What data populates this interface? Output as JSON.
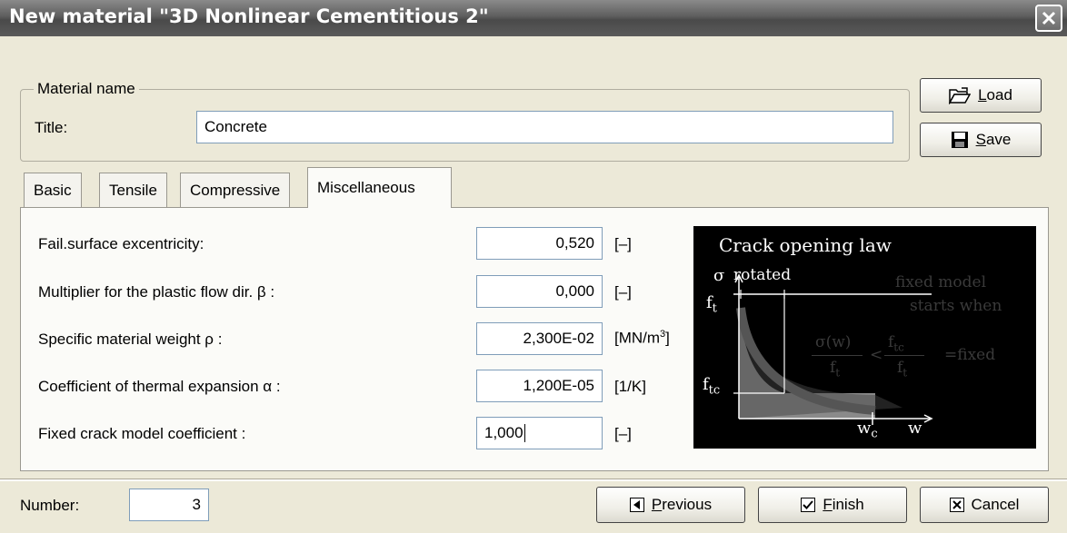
{
  "window": {
    "title": "New material \"3D Nonlinear Cementitious 2\""
  },
  "material_group": {
    "legend": "Material name",
    "title_label": "Title:",
    "title_value": "Concrete"
  },
  "buttons": {
    "load_prefix": "",
    "load_underline": "L",
    "load_rest": "oad",
    "save_underline": "S",
    "save_rest": "ave"
  },
  "tabs": [
    {
      "label": "Basic",
      "active": false
    },
    {
      "label": "Tensile",
      "active": false
    },
    {
      "label": "Compressive",
      "active": false
    },
    {
      "label": "Miscellaneous",
      "active": true
    }
  ],
  "fields": [
    {
      "label": "Fail.surface excentricity:",
      "value": "0,520",
      "unit": "[–]"
    },
    {
      "label": "Multiplier for the plastic flow dir. β :",
      "value": "0,000",
      "unit": "[–]"
    },
    {
      "label": "Specific material weight ρ :",
      "value": "2,300E-02",
      "unit_base": "[MN/m",
      "unit_sup": "3",
      "unit_end": "]"
    },
    {
      "label": "Coefficient of thermal expansion α :",
      "value": "1,200E-05",
      "unit": "[1/K]"
    },
    {
      "label": "Fixed crack model coefficient :",
      "value": "1,000",
      "unit": "[–]"
    }
  ],
  "diagram": {
    "title": "Crack opening law",
    "sigma": "σ",
    "rotated": "rotated",
    "fixed_line1": "fixed model",
    "fixed_line2": "starts when",
    "ft": "f",
    "ft_sub": "t",
    "ftc": "f",
    "ftc_sub": "tc",
    "wc": "w",
    "wc_sub": "c",
    "w": "w",
    "formula_num_left": "σ(w)",
    "formula_den_left": "f",
    "formula_den_left_sub": "t",
    "formula_lt": "<",
    "formula_num_right": "f",
    "formula_num_right_sub": "tc",
    "formula_den_right": "f",
    "formula_den_right_sub": "t",
    "formula_eq": "=fixed"
  },
  "footer": {
    "number_label": "Number:",
    "number_value": "3",
    "previous_underline": "P",
    "previous_rest": "revious",
    "finish_underline": "F",
    "finish_rest": "inish",
    "cancel_label": "Cancel"
  },
  "colors": {
    "title_bar": "#5e5e5e",
    "dialog_bg": "#ece9d8",
    "diagram_bg": "#000000"
  }
}
